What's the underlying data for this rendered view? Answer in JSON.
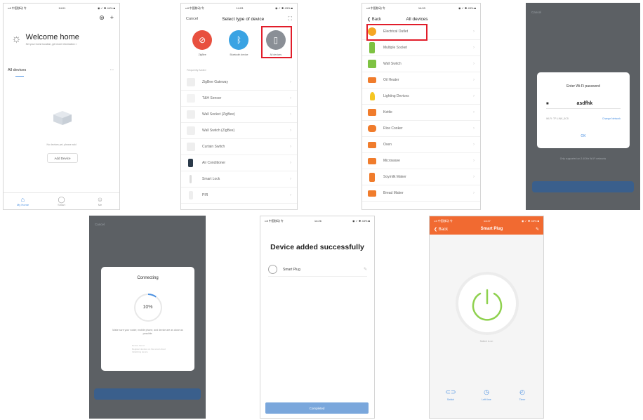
{
  "screen1": {
    "status": {
      "carrier": "••ll 中国移动 令",
      "time": "14:01",
      "battery": "◉ ✓ ✱ 44% ■"
    },
    "welcome_title": "Welcome home",
    "welcome_sub": "Set your home location, get more information >",
    "all_devices": "All devices",
    "more": "···",
    "empty_text": "No devices yet, please add",
    "add_button": "Add Device",
    "tabs": [
      {
        "label": "My Home"
      },
      {
        "label": "Smart"
      },
      {
        "label": "Me"
      }
    ]
  },
  "screen2": {
    "status": {
      "carrier": "••ll 中国移动 令",
      "time": "14:03",
      "battery": "◉ ✓ ✱ 43% ■"
    },
    "cancel": "Cancel",
    "title": "Select type of device",
    "categories": [
      {
        "label": "ZigBee"
      },
      {
        "label": "Bluetooth device"
      },
      {
        "label": "All devices"
      }
    ],
    "section": "Frequently Added",
    "items": [
      {
        "label": "ZigBee Gateway"
      },
      {
        "label": "T&H Sensor"
      },
      {
        "label": "Wall Socket (ZigBee)"
      },
      {
        "label": "Wall Switch (ZigBee)"
      },
      {
        "label": "Curtain Switch"
      },
      {
        "label": "Air Conditioner"
      },
      {
        "label": "Smart Lock"
      },
      {
        "label": "PIR"
      }
    ]
  },
  "screen3": {
    "status": {
      "carrier": "••ll 中国移动 令",
      "time": "14:03",
      "battery": "◉ ✓ ✱ 43% ■"
    },
    "back": "Back",
    "title": "All devices",
    "items": [
      {
        "label": "Electrical Outlet",
        "color": "#f5a623"
      },
      {
        "label": "Multiple Socket",
        "color": "#7ec242"
      },
      {
        "label": "Wall Switch",
        "color": "#7ec242"
      },
      {
        "label": "Oil Heater",
        "color": "#f07c2c"
      },
      {
        "label": "Lighting Devices",
        "color": "#f5c623"
      },
      {
        "label": "Kettle",
        "color": "#f07c2c"
      },
      {
        "label": "Rice Cooker",
        "color": "#f07c2c"
      },
      {
        "label": "Oven",
        "color": "#f07c2c"
      },
      {
        "label": "Microwave",
        "color": "#f07c2c"
      },
      {
        "label": "Soymilk Maker",
        "color": "#f07c2c"
      },
      {
        "label": "Bread Maker",
        "color": "#f07c2c"
      }
    ]
  },
  "screen4": {
    "cancel": "Cancel",
    "dialog_title": "Enter Wi-Fi password",
    "password": "asdfhk",
    "wifi_name": "Wi-Fi: TP-LINK_5C5",
    "change_network": "Change Network",
    "ok": "OK",
    "note": "Only supported on 2.4GHz Wi-Fi networks"
  },
  "screen5": {
    "cancel": "Cancel",
    "title": "Connecting",
    "progress": "10%",
    "progress_value": 0.1,
    "hint": "Make sure your router, mobile phone, and device are as close as possible.",
    "steps": [
      "Device found",
      "Register devices on the smart cloud",
      "Initializing device"
    ]
  },
  "screen6": {
    "status": {
      "carrier": "••ll 中国移动 令",
      "time": "14:26",
      "battery": "◉ ✓ ✱ 43% ■"
    },
    "title": "Device added successfully",
    "device": "Smart Plug",
    "completed": "Completed"
  },
  "screen7": {
    "status": {
      "carrier": "••ll 中国移动 令",
      "time": "14:27",
      "battery": "◉ ✓ ✱ 43% ■"
    },
    "back": "Back",
    "title": "Smart Plug",
    "state": "Switch is on",
    "actions": [
      {
        "label": "Switch"
      },
      {
        "label": "Left time"
      },
      {
        "label": "Timer"
      }
    ],
    "accent": "#f16a31",
    "power_color": "#8fd14f"
  }
}
